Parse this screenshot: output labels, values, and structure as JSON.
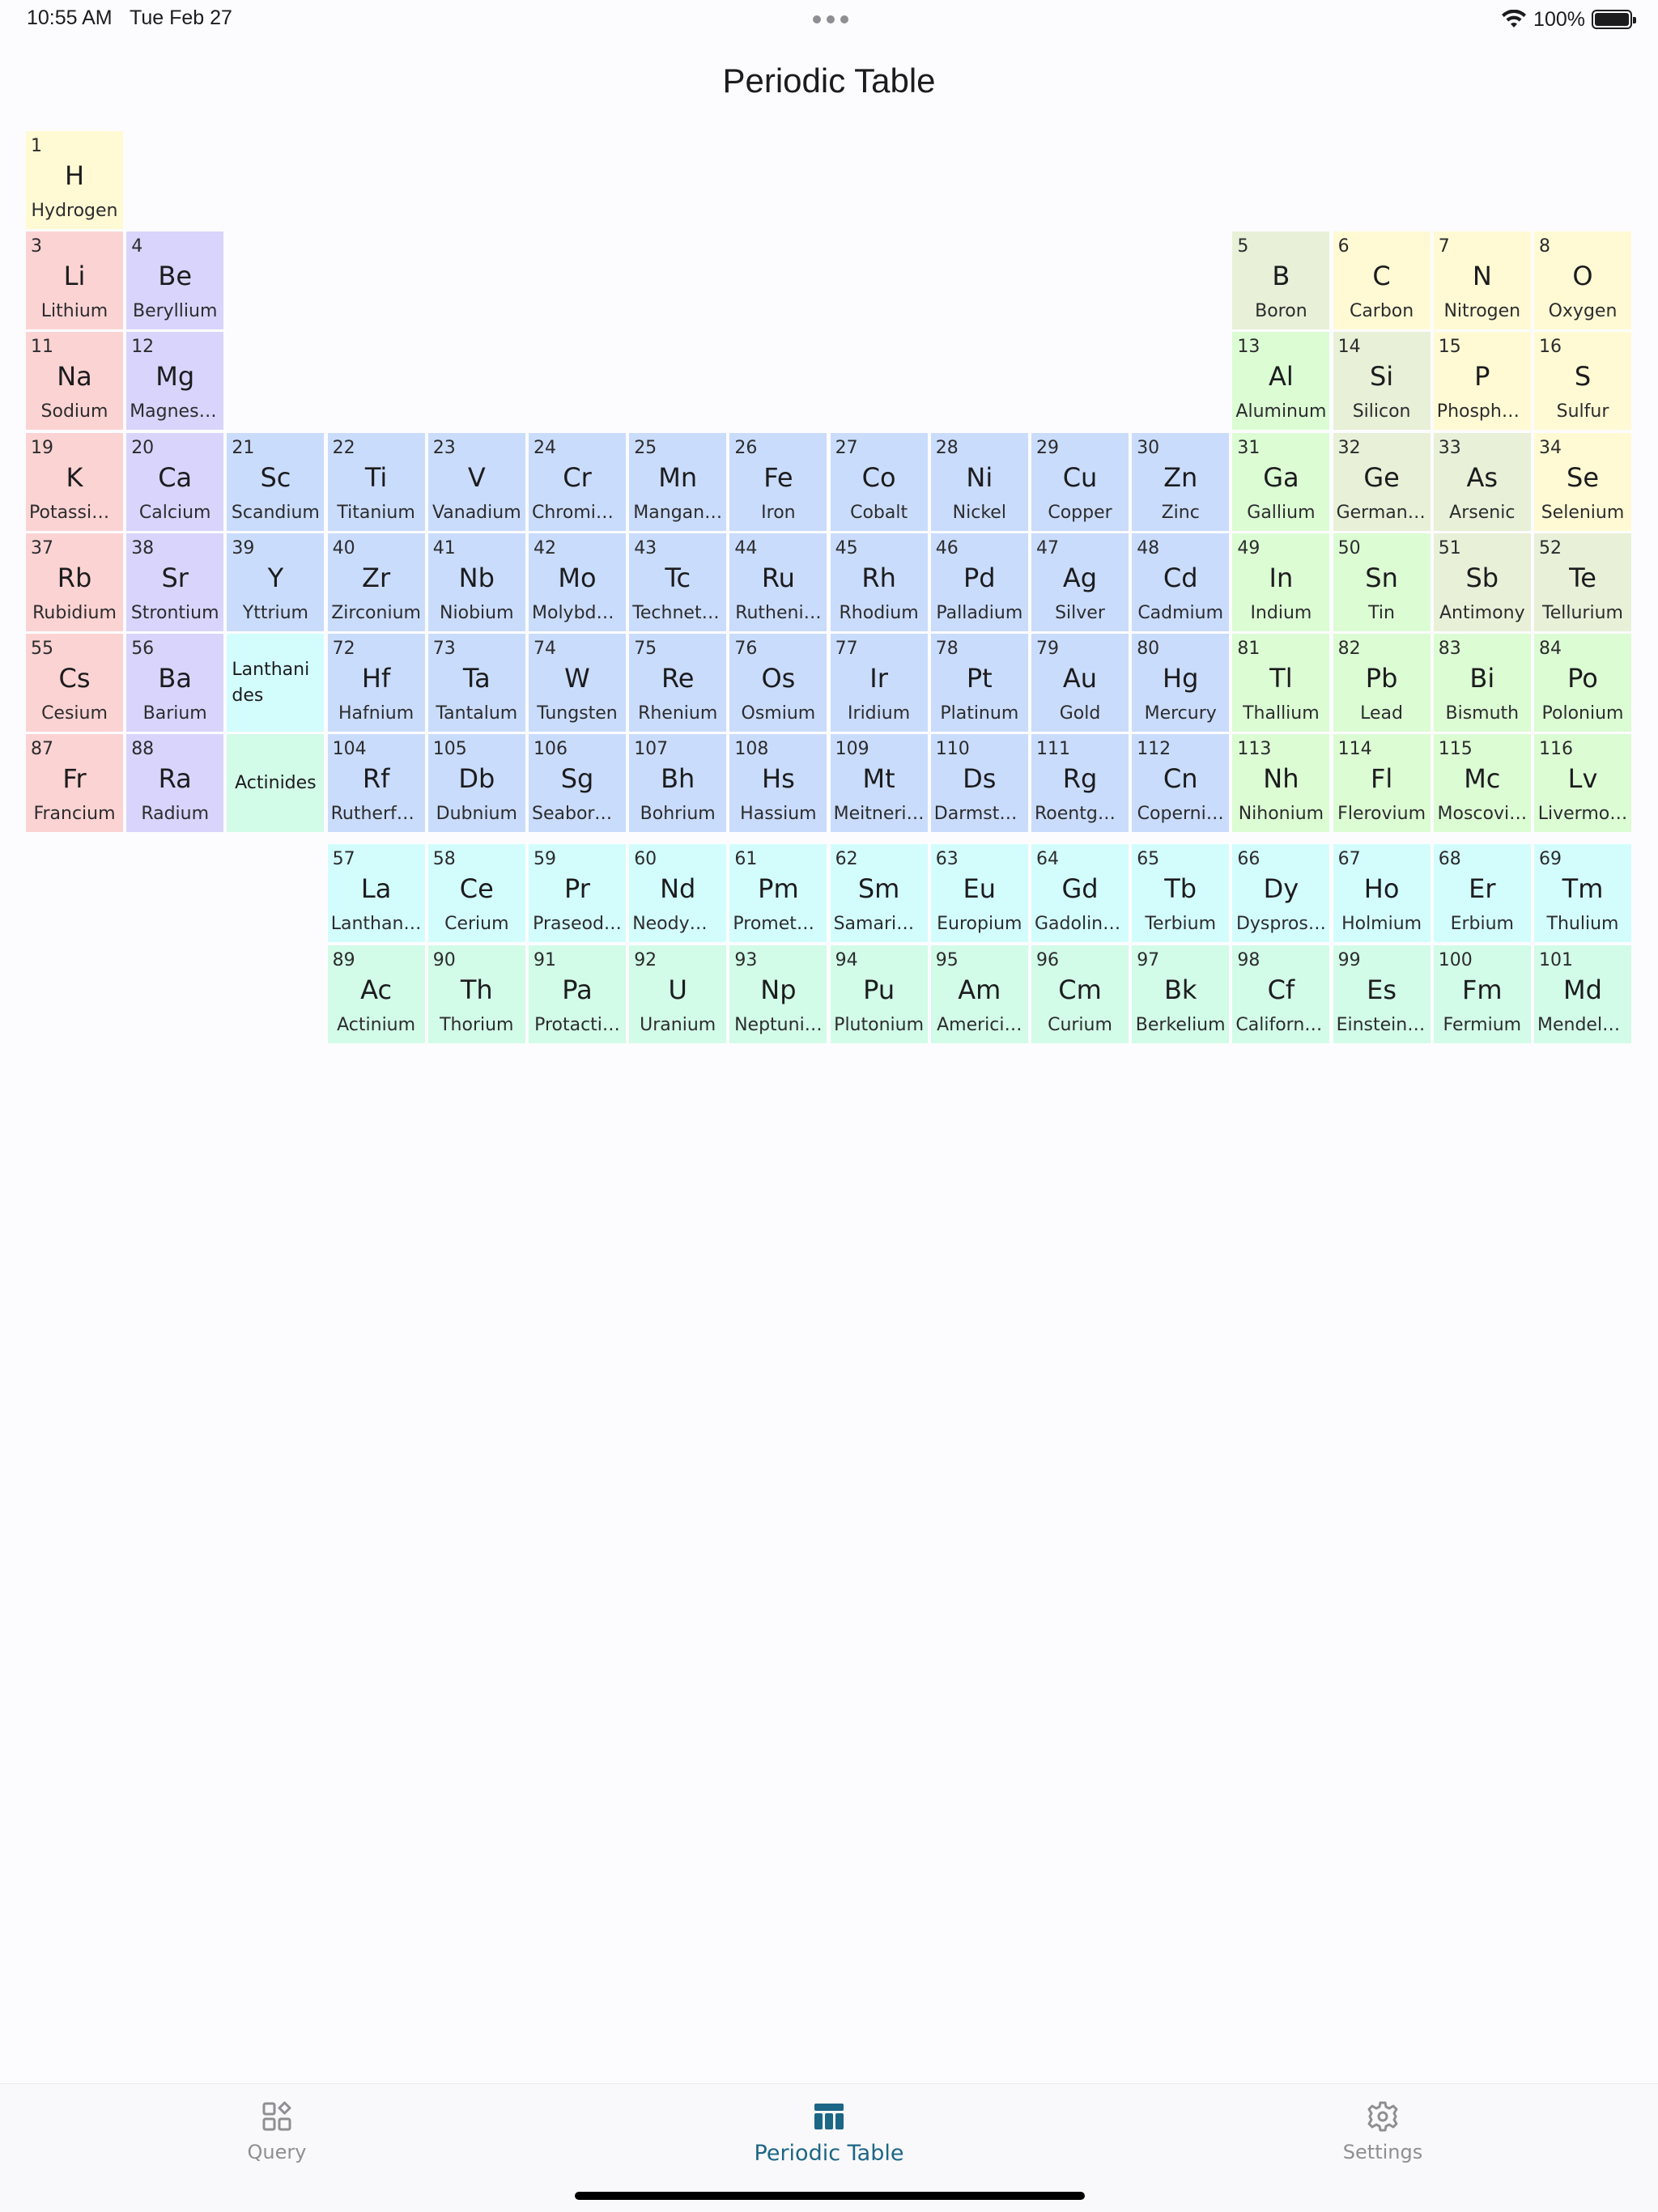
{
  "status_bar": {
    "time": "10:55 AM",
    "date": "Tue Feb 27",
    "battery": "100%"
  },
  "title": "Periodic Table",
  "category_colors": {
    "alkali": "#fcd3d3",
    "alkaline": "#d8d4fb",
    "transition": "#cadcfb",
    "post_transition": "#dcfcd4",
    "metalloid": "#e8f0d8",
    "nonmetal": "#fffad4",
    "lanthanide": "#d3fdfc",
    "actinide": "#d2fbe8"
  },
  "elements": [
    {
      "n": "1",
      "s": "H",
      "name": "Hydrogen",
      "row": 1,
      "col": 1,
      "cat": "nonmetal"
    },
    {
      "n": "3",
      "s": "Li",
      "name": "Lithium",
      "row": 2,
      "col": 1,
      "cat": "alkali"
    },
    {
      "n": "4",
      "s": "Be",
      "name": "Beryllium",
      "row": 2,
      "col": 2,
      "cat": "alkaline"
    },
    {
      "n": "5",
      "s": "B",
      "name": "Boron",
      "row": 2,
      "col": 13,
      "cat": "metalloid"
    },
    {
      "n": "6",
      "s": "C",
      "name": "Carbon",
      "row": 2,
      "col": 14,
      "cat": "nonmetal"
    },
    {
      "n": "7",
      "s": "N",
      "name": "Nitrogen",
      "row": 2,
      "col": 15,
      "cat": "nonmetal"
    },
    {
      "n": "8",
      "s": "O",
      "name": "Oxygen",
      "row": 2,
      "col": 16,
      "cat": "nonmetal"
    },
    {
      "n": "11",
      "s": "Na",
      "name": "Sodium",
      "row": 3,
      "col": 1,
      "cat": "alkali"
    },
    {
      "n": "12",
      "s": "Mg",
      "name": "Magnesi…",
      "row": 3,
      "col": 2,
      "cat": "alkaline"
    },
    {
      "n": "13",
      "s": "Al",
      "name": "Aluminum",
      "row": 3,
      "col": 13,
      "cat": "post_transition"
    },
    {
      "n": "14",
      "s": "Si",
      "name": "Silicon",
      "row": 3,
      "col": 14,
      "cat": "metalloid"
    },
    {
      "n": "15",
      "s": "P",
      "name": "Phospho…",
      "row": 3,
      "col": 15,
      "cat": "nonmetal"
    },
    {
      "n": "16",
      "s": "S",
      "name": "Sulfur",
      "row": 3,
      "col": 16,
      "cat": "nonmetal"
    },
    {
      "n": "19",
      "s": "K",
      "name": "Potassium",
      "row": 4,
      "col": 1,
      "cat": "alkali"
    },
    {
      "n": "20",
      "s": "Ca",
      "name": "Calcium",
      "row": 4,
      "col": 2,
      "cat": "alkaline"
    },
    {
      "n": "21",
      "s": "Sc",
      "name": "Scandium",
      "row": 4,
      "col": 3,
      "cat": "transition"
    },
    {
      "n": "22",
      "s": "Ti",
      "name": "Titanium",
      "row": 4,
      "col": 4,
      "cat": "transition"
    },
    {
      "n": "23",
      "s": "V",
      "name": "Vanadium",
      "row": 4,
      "col": 5,
      "cat": "transition"
    },
    {
      "n": "24",
      "s": "Cr",
      "name": "Chromium",
      "row": 4,
      "col": 6,
      "cat": "transition"
    },
    {
      "n": "25",
      "s": "Mn",
      "name": "Mangan…",
      "row": 4,
      "col": 7,
      "cat": "transition"
    },
    {
      "n": "26",
      "s": "Fe",
      "name": "Iron",
      "row": 4,
      "col": 8,
      "cat": "transition"
    },
    {
      "n": "27",
      "s": "Co",
      "name": "Cobalt",
      "row": 4,
      "col": 9,
      "cat": "transition"
    },
    {
      "n": "28",
      "s": "Ni",
      "name": "Nickel",
      "row": 4,
      "col": 10,
      "cat": "transition"
    },
    {
      "n": "29",
      "s": "Cu",
      "name": "Copper",
      "row": 4,
      "col": 11,
      "cat": "transition"
    },
    {
      "n": "30",
      "s": "Zn",
      "name": "Zinc",
      "row": 4,
      "col": 12,
      "cat": "transition"
    },
    {
      "n": "31",
      "s": "Ga",
      "name": "Gallium",
      "row": 4,
      "col": 13,
      "cat": "post_transition"
    },
    {
      "n": "32",
      "s": "Ge",
      "name": "Germani…",
      "row": 4,
      "col": 14,
      "cat": "metalloid"
    },
    {
      "n": "33",
      "s": "As",
      "name": "Arsenic",
      "row": 4,
      "col": 15,
      "cat": "metalloid"
    },
    {
      "n": "34",
      "s": "Se",
      "name": "Selenium",
      "row": 4,
      "col": 16,
      "cat": "nonmetal"
    },
    {
      "n": "37",
      "s": "Rb",
      "name": "Rubidium",
      "row": 5,
      "col": 1,
      "cat": "alkali"
    },
    {
      "n": "38",
      "s": "Sr",
      "name": "Strontium",
      "row": 5,
      "col": 2,
      "cat": "alkaline"
    },
    {
      "n": "39",
      "s": "Y",
      "name": "Yttrium",
      "row": 5,
      "col": 3,
      "cat": "transition"
    },
    {
      "n": "40",
      "s": "Zr",
      "name": "Zirconium",
      "row": 5,
      "col": 4,
      "cat": "transition"
    },
    {
      "n": "41",
      "s": "Nb",
      "name": "Niobium",
      "row": 5,
      "col": 5,
      "cat": "transition"
    },
    {
      "n": "42",
      "s": "Mo",
      "name": "Molybde…",
      "row": 5,
      "col": 6,
      "cat": "transition"
    },
    {
      "n": "43",
      "s": "Tc",
      "name": "Techneti…",
      "row": 5,
      "col": 7,
      "cat": "transition"
    },
    {
      "n": "44",
      "s": "Ru",
      "name": "Rutheni…",
      "row": 5,
      "col": 8,
      "cat": "transition"
    },
    {
      "n": "45",
      "s": "Rh",
      "name": "Rhodium",
      "row": 5,
      "col": 9,
      "cat": "transition"
    },
    {
      "n": "46",
      "s": "Pd",
      "name": "Palladium",
      "row": 5,
      "col": 10,
      "cat": "transition"
    },
    {
      "n": "47",
      "s": "Ag",
      "name": "Silver",
      "row": 5,
      "col": 11,
      "cat": "transition"
    },
    {
      "n": "48",
      "s": "Cd",
      "name": "Cadmium",
      "row": 5,
      "col": 12,
      "cat": "transition"
    },
    {
      "n": "49",
      "s": "In",
      "name": "Indium",
      "row": 5,
      "col": 13,
      "cat": "post_transition"
    },
    {
      "n": "50",
      "s": "Sn",
      "name": "Tin",
      "row": 5,
      "col": 14,
      "cat": "post_transition"
    },
    {
      "n": "51",
      "s": "Sb",
      "name": "Antimony",
      "row": 5,
      "col": 15,
      "cat": "metalloid"
    },
    {
      "n": "52",
      "s": "Te",
      "name": "Tellurium",
      "row": 5,
      "col": 16,
      "cat": "metalloid"
    },
    {
      "n": "55",
      "s": "Cs",
      "name": "Cesium",
      "row": 6,
      "col": 1,
      "cat": "alkali"
    },
    {
      "n": "56",
      "s": "Ba",
      "name": "Barium",
      "row": 6,
      "col": 2,
      "cat": "alkaline"
    },
    {
      "n": "72",
      "s": "Hf",
      "name": "Hafnium",
      "row": 6,
      "col": 4,
      "cat": "transition"
    },
    {
      "n": "73",
      "s": "Ta",
      "name": "Tantalum",
      "row": 6,
      "col": 5,
      "cat": "transition"
    },
    {
      "n": "74",
      "s": "W",
      "name": "Tungsten",
      "row": 6,
      "col": 6,
      "cat": "transition"
    },
    {
      "n": "75",
      "s": "Re",
      "name": "Rhenium",
      "row": 6,
      "col": 7,
      "cat": "transition"
    },
    {
      "n": "76",
      "s": "Os",
      "name": "Osmium",
      "row": 6,
      "col": 8,
      "cat": "transition"
    },
    {
      "n": "77",
      "s": "Ir",
      "name": "Iridium",
      "row": 6,
      "col": 9,
      "cat": "transition"
    },
    {
      "n": "78",
      "s": "Pt",
      "name": "Platinum",
      "row": 6,
      "col": 10,
      "cat": "transition"
    },
    {
      "n": "79",
      "s": "Au",
      "name": "Gold",
      "row": 6,
      "col": 11,
      "cat": "transition"
    },
    {
      "n": "80",
      "s": "Hg",
      "name": "Mercury",
      "row": 6,
      "col": 12,
      "cat": "transition"
    },
    {
      "n": "81",
      "s": "Tl",
      "name": "Thallium",
      "row": 6,
      "col": 13,
      "cat": "post_transition"
    },
    {
      "n": "82",
      "s": "Pb",
      "name": "Lead",
      "row": 6,
      "col": 14,
      "cat": "post_transition"
    },
    {
      "n": "83",
      "s": "Bi",
      "name": "Bismuth",
      "row": 6,
      "col": 15,
      "cat": "post_transition"
    },
    {
      "n": "84",
      "s": "Po",
      "name": "Polonium",
      "row": 6,
      "col": 16,
      "cat": "post_transition"
    },
    {
      "n": "87",
      "s": "Fr",
      "name": "Francium",
      "row": 7,
      "col": 1,
      "cat": "alkali"
    },
    {
      "n": "88",
      "s": "Ra",
      "name": "Radium",
      "row": 7,
      "col": 2,
      "cat": "alkaline"
    },
    {
      "n": "104",
      "s": "Rf",
      "name": "Rutherfo…",
      "row": 7,
      "col": 4,
      "cat": "transition"
    },
    {
      "n": "105",
      "s": "Db",
      "name": "Dubnium",
      "row": 7,
      "col": 5,
      "cat": "transition"
    },
    {
      "n": "106",
      "s": "Sg",
      "name": "Seaborg…",
      "row": 7,
      "col": 6,
      "cat": "transition"
    },
    {
      "n": "107",
      "s": "Bh",
      "name": "Bohrium",
      "row": 7,
      "col": 7,
      "cat": "transition"
    },
    {
      "n": "108",
      "s": "Hs",
      "name": "Hassium",
      "row": 7,
      "col": 8,
      "cat": "transition"
    },
    {
      "n": "109",
      "s": "Mt",
      "name": "Meitneri…",
      "row": 7,
      "col": 9,
      "cat": "transition"
    },
    {
      "n": "110",
      "s": "Ds",
      "name": "Darmsta…",
      "row": 7,
      "col": 10,
      "cat": "transition"
    },
    {
      "n": "111",
      "s": "Rg",
      "name": "Roentge…",
      "row": 7,
      "col": 11,
      "cat": "transition"
    },
    {
      "n": "112",
      "s": "Cn",
      "name": "Coperni…",
      "row": 7,
      "col": 12,
      "cat": "transition"
    },
    {
      "n": "113",
      "s": "Nh",
      "name": "Nihonium",
      "row": 7,
      "col": 13,
      "cat": "post_transition"
    },
    {
      "n": "114",
      "s": "Fl",
      "name": "Flerovium",
      "row": 7,
      "col": 14,
      "cat": "post_transition"
    },
    {
      "n": "115",
      "s": "Mc",
      "name": "Moscovi…",
      "row": 7,
      "col": 15,
      "cat": "post_transition"
    },
    {
      "n": "116",
      "s": "Lv",
      "name": "Livermo…",
      "row": 7,
      "col": 16,
      "cat": "post_transition"
    },
    {
      "n": "57",
      "s": "La",
      "name": "Lanthan…",
      "row": 8,
      "col": 4,
      "cat": "lanthanide"
    },
    {
      "n": "58",
      "s": "Ce",
      "name": "Cerium",
      "row": 8,
      "col": 5,
      "cat": "lanthanide"
    },
    {
      "n": "59",
      "s": "Pr",
      "name": "Praseod…",
      "row": 8,
      "col": 6,
      "cat": "lanthanide"
    },
    {
      "n": "60",
      "s": "Nd",
      "name": "Neodym…",
      "row": 8,
      "col": 7,
      "cat": "lanthanide"
    },
    {
      "n": "61",
      "s": "Pm",
      "name": "Prometh…",
      "row": 8,
      "col": 8,
      "cat": "lanthanide"
    },
    {
      "n": "62",
      "s": "Sm",
      "name": "Samarium",
      "row": 8,
      "col": 9,
      "cat": "lanthanide"
    },
    {
      "n": "63",
      "s": "Eu",
      "name": "Europium",
      "row": 8,
      "col": 10,
      "cat": "lanthanide"
    },
    {
      "n": "64",
      "s": "Gd",
      "name": "Gadolini…",
      "row": 8,
      "col": 11,
      "cat": "lanthanide"
    },
    {
      "n": "65",
      "s": "Tb",
      "name": "Terbium",
      "row": 8,
      "col": 12,
      "cat": "lanthanide"
    },
    {
      "n": "66",
      "s": "Dy",
      "name": "Dyspros…",
      "row": 8,
      "col": 13,
      "cat": "lanthanide"
    },
    {
      "n": "67",
      "s": "Ho",
      "name": "Holmium",
      "row": 8,
      "col": 14,
      "cat": "lanthanide"
    },
    {
      "n": "68",
      "s": "Er",
      "name": "Erbium",
      "row": 8,
      "col": 15,
      "cat": "lanthanide"
    },
    {
      "n": "69",
      "s": "Tm",
      "name": "Thulium",
      "row": 8,
      "col": 16,
      "cat": "lanthanide"
    },
    {
      "n": "89",
      "s": "Ac",
      "name": "Actinium",
      "row": 9,
      "col": 4,
      "cat": "actinide"
    },
    {
      "n": "90",
      "s": "Th",
      "name": "Thorium",
      "row": 9,
      "col": 5,
      "cat": "actinide"
    },
    {
      "n": "91",
      "s": "Pa",
      "name": "Protacti…",
      "row": 9,
      "col": 6,
      "cat": "actinide"
    },
    {
      "n": "92",
      "s": "U",
      "name": "Uranium",
      "row": 9,
      "col": 7,
      "cat": "actinide"
    },
    {
      "n": "93",
      "s": "Np",
      "name": "Neptuni…",
      "row": 9,
      "col": 8,
      "cat": "actinide"
    },
    {
      "n": "94",
      "s": "Pu",
      "name": "Plutonium",
      "row": 9,
      "col": 9,
      "cat": "actinide"
    },
    {
      "n": "95",
      "s": "Am",
      "name": "Americi…",
      "row": 9,
      "col": 10,
      "cat": "actinide"
    },
    {
      "n": "96",
      "s": "Cm",
      "name": "Curium",
      "row": 9,
      "col": 11,
      "cat": "actinide"
    },
    {
      "n": "97",
      "s": "Bk",
      "name": "Berkelium",
      "row": 9,
      "col": 12,
      "cat": "actinide"
    },
    {
      "n": "98",
      "s": "Cf",
      "name": "Californi…",
      "row": 9,
      "col": 13,
      "cat": "actinide"
    },
    {
      "n": "99",
      "s": "Es",
      "name": "Einsteini…",
      "row": 9,
      "col": 14,
      "cat": "actinide"
    },
    {
      "n": "100",
      "s": "Fm",
      "name": "Fermium",
      "row": 9,
      "col": 15,
      "cat": "actinide"
    },
    {
      "n": "101",
      "s": "Md",
      "name": "Mendele…",
      "row": 9,
      "col": 16,
      "cat": "actinide"
    }
  ],
  "placeholders": [
    {
      "label": "Lanthanides",
      "row": 6,
      "col": 3,
      "cat": "lanthanide",
      "align": "left"
    },
    {
      "label": "Actinides",
      "row": 7,
      "col": 3,
      "cat": "actinide",
      "align": "center"
    }
  ],
  "tabs": [
    {
      "label": "Query",
      "icon": "query-icon",
      "active": false
    },
    {
      "label": "Periodic Table",
      "icon": "table-icon",
      "active": true
    },
    {
      "label": "Settings",
      "icon": "gear-icon",
      "active": false
    }
  ],
  "colors": {
    "accent": "#1c6686",
    "tab_inactive": "#8e8e93"
  }
}
